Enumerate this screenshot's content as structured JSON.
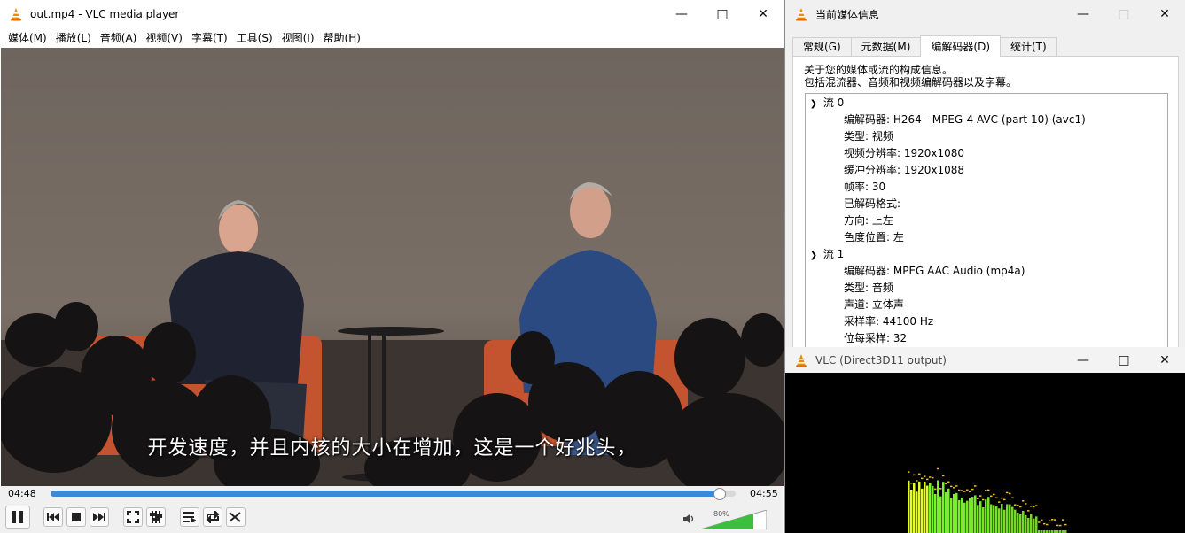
{
  "main": {
    "title": "out.mp4 - VLC media player",
    "menu": [
      "媒体(M)",
      "播放(L)",
      "音频(A)",
      "视频(V)",
      "字幕(T)",
      "工具(S)",
      "视图(I)",
      "帮助(H)"
    ],
    "subtitle": "开发速度，并且内核的大小在增加，这是一个好兆头，",
    "time_elapsed": "04:48",
    "time_total": "04:55",
    "progress": 0.976,
    "volume_label": "80%",
    "volume": 0.8,
    "accent_color": "#3c8ad6",
    "caption_icons": [
      "minimize-icon",
      "maximize-icon",
      "close-icon"
    ],
    "control_icons": [
      "pause-icon",
      "previous-icon",
      "stop-icon",
      "next-icon",
      "fullscreen-icon",
      "extended-settings-icon",
      "playlist-icon",
      "loop-icon",
      "shuffle-icon",
      "volume-icon"
    ]
  },
  "info": {
    "title": "当前媒体信息",
    "tabs": [
      "常规(G)",
      "元数据(M)",
      "编解码器(D)",
      "统计(T)"
    ],
    "active_tab": 2,
    "desc1": "关于您的媒体或流的构成信息。",
    "desc2": "包括混流器、音频和视频编解码器以及字幕。",
    "streams": [
      {
        "label": "流 0",
        "rows": [
          "编解码器: H264 - MPEG-4 AVC (part 10) (avc1)",
          "类型: 视频",
          "视频分辨率: 1920x1080",
          "缓冲分辨率: 1920x1088",
          "帧率: 30",
          "已解码格式:",
          "方向: 上左",
          "色度位置: 左"
        ]
      },
      {
        "label": "流 1",
        "rows": [
          "编解码器: MPEG AAC Audio (mp4a)",
          "类型: 音频",
          "声道: 立体声",
          "采样率: 44100 Hz",
          "位每采样: 32"
        ]
      }
    ]
  },
  "output": {
    "title": "VLC (Direct3D11 output)"
  }
}
